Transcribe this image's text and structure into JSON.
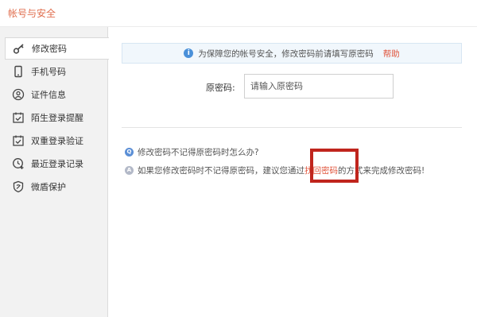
{
  "window": {
    "title": "帐号与安全"
  },
  "sidebar": {
    "items": [
      {
        "label": "修改密码",
        "icon": "key-icon",
        "active": true
      },
      {
        "label": "手机号码",
        "icon": "phone-icon"
      },
      {
        "label": "证件信息",
        "icon": "id-card-icon"
      },
      {
        "label": "陌生登录提醒",
        "icon": "calendar-check-icon"
      },
      {
        "label": "双重登录验证",
        "icon": "calendar-check-icon"
      },
      {
        "label": "最近登录记录",
        "icon": "clock-plus-icon"
      },
      {
        "label": "微盾保护",
        "icon": "shield-icon"
      }
    ]
  },
  "main": {
    "notice": {
      "text": "为保障您的帐号安全，修改密码前请填写原密码",
      "help": "帮助"
    },
    "form": {
      "old_password_label": "原密码:",
      "old_password_placeholder": "请输入原密码",
      "old_password_value": ""
    },
    "faq": {
      "question": "修改密码不记得原密码时怎么办?",
      "answer_prefix": "如果您修改密码时不记得原密码，建议您通过",
      "answer_link": "找回密码",
      "answer_suffix": "的方式来完成修改密码!"
    }
  },
  "colors": {
    "accent": "#e0533a",
    "highlight": "#c0251d",
    "title": "#e06e4e"
  }
}
